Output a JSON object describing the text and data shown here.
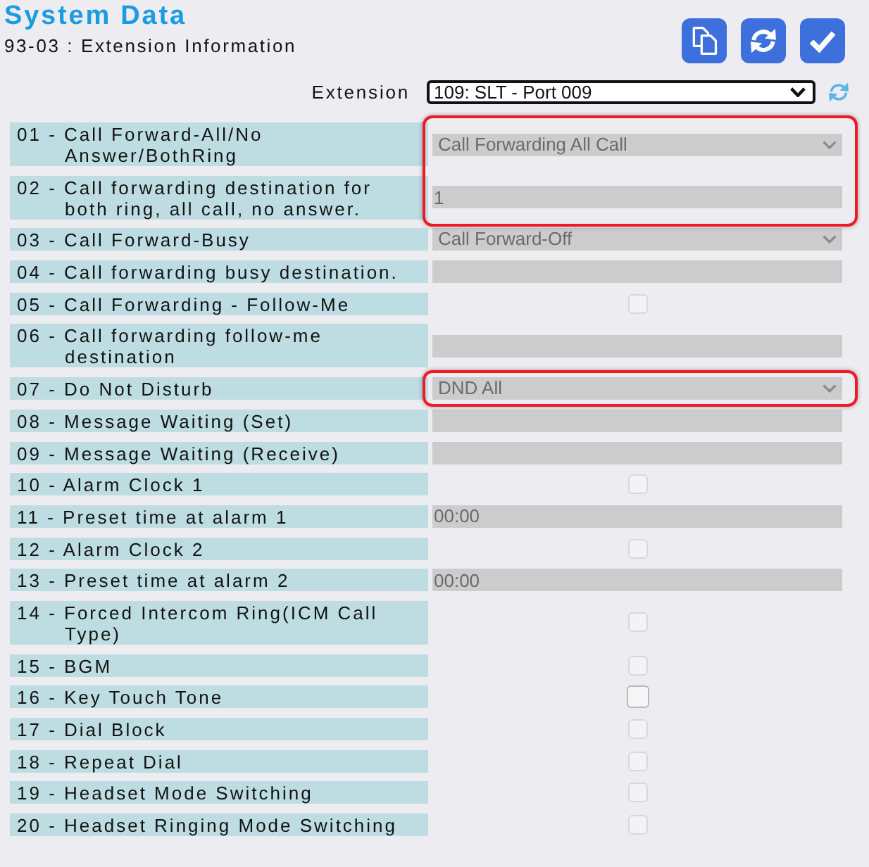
{
  "header": {
    "title": "System Data",
    "subtitle": "93-03 : Extension Information"
  },
  "extension": {
    "label": "Extension",
    "value": "109: SLT - Port 009"
  },
  "rows": [
    {
      "label": "01 - Call Forward-All/No Answer/BothRing",
      "kind": "select",
      "value": "Call Forwarding All Call",
      "disabled": true,
      "highlighted": true
    },
    {
      "label": "02 - Call forwarding destination for both ring, all call, no answer.",
      "kind": "text",
      "value": "1",
      "disabled": true,
      "highlighted": true
    },
    {
      "label": "03 - Call Forward-Busy",
      "kind": "select",
      "value": "Call Forward-Off",
      "disabled": true,
      "highlighted": false
    },
    {
      "label": "04 - Call forwarding busy destination.",
      "kind": "text",
      "disabled": true,
      "highlighted": false
    },
    {
      "label": "05 - Call Forwarding - Follow-Me",
      "kind": "checkbox",
      "checked": false,
      "disabled": true,
      "highlighted": false
    },
    {
      "label": "06 - Call forwarding follow-me destination",
      "kind": "text",
      "disabled": true,
      "highlighted": false
    },
    {
      "label": "07 - Do Not Disturb",
      "kind": "select",
      "value": "DND All",
      "disabled": true,
      "highlighted": true
    },
    {
      "label": "08 - Message Waiting (Set)",
      "kind": "text",
      "disabled": true,
      "highlighted": false
    },
    {
      "label": "09 - Message Waiting (Receive)",
      "kind": "text",
      "disabled": true,
      "highlighted": false
    },
    {
      "label": "10 - Alarm Clock 1",
      "kind": "checkbox",
      "checked": false,
      "disabled": true,
      "highlighted": false
    },
    {
      "label": "11 - Preset time at alarm 1",
      "kind": "text",
      "value": "00:00",
      "disabled": true,
      "highlighted": false
    },
    {
      "label": "12 - Alarm Clock 2",
      "kind": "checkbox",
      "checked": false,
      "disabled": true,
      "highlighted": false
    },
    {
      "label": "13 - Preset time at alarm 2",
      "kind": "text",
      "value": "00:00",
      "disabled": true,
      "highlighted": false
    },
    {
      "label": "14 - Forced Intercom Ring(ICM Call Type)",
      "kind": "checkbox",
      "checked": false,
      "disabled": true,
      "highlighted": false
    },
    {
      "label": "15 - BGM",
      "kind": "checkbox",
      "checked": false,
      "disabled": true,
      "highlighted": false
    },
    {
      "label": "16 - Key Touch Tone",
      "kind": "checkbox",
      "checked": false,
      "disabled": false,
      "highlighted": false
    },
    {
      "label": "17 - Dial Block",
      "kind": "checkbox",
      "checked": false,
      "disabled": true,
      "highlighted": false
    },
    {
      "label": "18 - Repeat Dial",
      "kind": "checkbox",
      "checked": false,
      "disabled": true,
      "highlighted": false
    },
    {
      "label": "19 - Headset Mode Switching",
      "kind": "checkbox",
      "checked": false,
      "disabled": true,
      "highlighted": false
    },
    {
      "label": "20 - Headset Ringing Mode Switching",
      "kind": "checkbox",
      "checked": false,
      "disabled": true,
      "highlighted": false
    }
  ]
}
